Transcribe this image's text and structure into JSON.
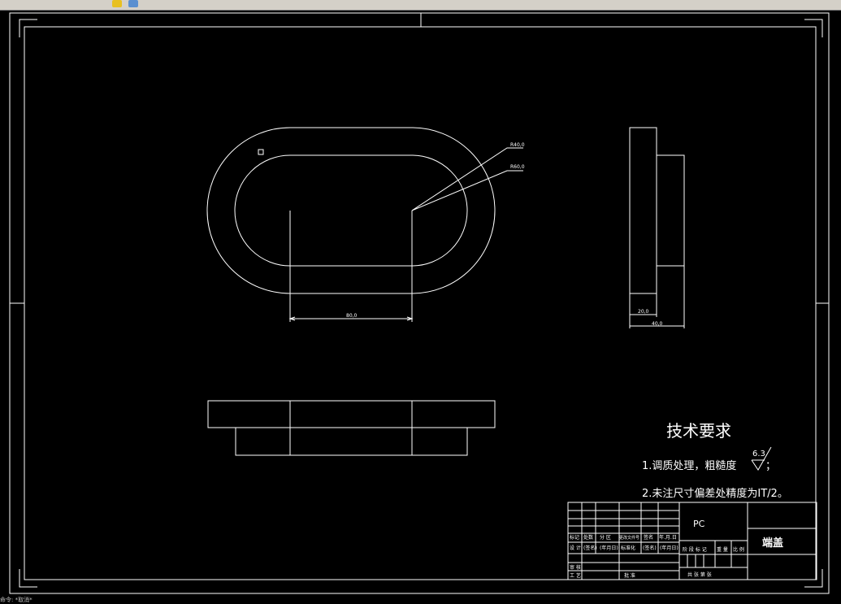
{
  "toolbar": {
    "icons": [
      "open-file-icon",
      "layer-icon"
    ]
  },
  "drawing": {
    "dims": {
      "r_inner": "R40,0",
      "r_outer": "R60,0",
      "length": "80,0",
      "side_width_1": "20,0",
      "side_width_2": "40,0"
    },
    "tech": {
      "title": "技术要求",
      "line1": "1.调质处理，粗糙度",
      "roughness_value": "6.3",
      "line1_end": "；",
      "line2": "2.未注尺寸偏差处精度为IT/2。"
    },
    "title_block": {
      "material": "PC",
      "part_name": "端盖",
      "row_labels_1": [
        "标记",
        "处数",
        "分 区",
        "更改文件号",
        "签名",
        "年.月.日"
      ],
      "row_labels_2": [
        "设 计",
        "(签名)",
        "(年月日)",
        "标准化",
        "(签名)",
        "(年月日)"
      ],
      "stage_labels": [
        "阶 段 标 记",
        "重 量",
        "比 例"
      ],
      "review_label": "审 核",
      "process_label": "工 艺",
      "approve_label": "批 准",
      "sheet_labels": "共 张  第 张"
    }
  },
  "status": {
    "command_text": "命令: *取消*"
  },
  "colors": {
    "background": "#000000",
    "line": "#ffffff",
    "toolbar": "#d4d0c8"
  }
}
